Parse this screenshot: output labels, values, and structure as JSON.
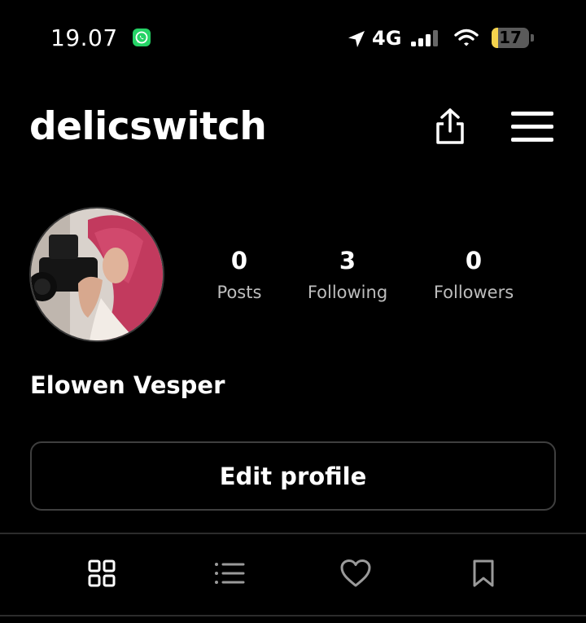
{
  "status_bar": {
    "time": "19.07",
    "network": "4G",
    "battery_level": "17",
    "battery_fraction": 0.17,
    "icons": [
      "whatsapp-icon",
      "location-arrow-icon",
      "signal-bars-icon",
      "wifi-icon",
      "battery-icon"
    ]
  },
  "header": {
    "username": "delicswitch",
    "icons": [
      "share-icon",
      "menu-icon"
    ]
  },
  "profile": {
    "full_name": "Elowen Vesper",
    "stats": [
      {
        "value": "0",
        "label": "Posts"
      },
      {
        "value": "3",
        "label": "Following"
      },
      {
        "value": "0",
        "label": "Followers"
      }
    ]
  },
  "actions": {
    "edit_profile_label": "Edit profile"
  },
  "tabs": [
    "grid-icon",
    "list-icon",
    "heart-icon",
    "bookmark-icon"
  ],
  "colors": {
    "background": "#000000",
    "text": "#ffffff",
    "muted_text": "#bdbdbd",
    "border": "#3f3f3f",
    "battery_low": "#f5d34d",
    "whatsapp": "#25d366"
  }
}
